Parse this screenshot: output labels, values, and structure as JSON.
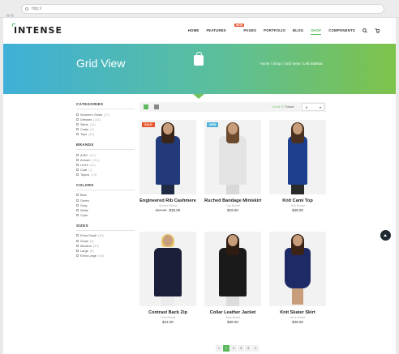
{
  "browser": {
    "url": "http://"
  },
  "site": {
    "logo": "INTENSE"
  },
  "nav": {
    "items": [
      {
        "label": "HOME"
      },
      {
        "label": "FEATURES",
        "badge": "NEW"
      },
      {
        "label": "PAGES"
      },
      {
        "label": "PORTFOLIO"
      },
      {
        "label": "BLOG"
      },
      {
        "label": "SHOP",
        "active": true
      },
      {
        "label": "COMPONENTS"
      }
    ],
    "search_icon": "search-icon",
    "cart_icon": "cart-icon"
  },
  "hero": {
    "title": "Grid View",
    "breadcrumb": "Home  /  Shop  /  Grid View  /  Left Sidebar"
  },
  "sidebar": {
    "categories": {
      "title": "CATEGORIES",
      "items": [
        {
          "label": "Women's Shirts",
          "count": "(27)"
        },
        {
          "label": "Dresses",
          "count": "(211)"
        },
        {
          "label": "Skirts",
          "count": "(12)"
        },
        {
          "label": "Coats",
          "count": "(7)"
        },
        {
          "label": "Tops",
          "count": "(19)"
        }
      ]
    },
    "brands": {
      "title": "BRANDS",
      "items": [
        {
          "label": "AJEC",
          "count": "(27)"
        },
        {
          "label": "Armani",
          "count": "(211)"
        },
        {
          "label": "Levi's",
          "count": "(12)"
        },
        {
          "label": "Coat",
          "count": "(7)"
        },
        {
          "label": "Topins",
          "count": "(19)"
        }
      ]
    },
    "colors": {
      "title": "COLORS",
      "items": [
        {
          "label": "Blue"
        },
        {
          "label": "Green"
        },
        {
          "label": "Gray"
        },
        {
          "label": "White"
        },
        {
          "label": "Cyan"
        }
      ]
    },
    "sizes": {
      "title": "SIZES",
      "items": [
        {
          "label": "Extra Small",
          "count": "(30)"
        },
        {
          "label": "Small",
          "count": "(5)"
        },
        {
          "label": "Medium",
          "count": "(90)"
        },
        {
          "label": "Large",
          "count": "(5)"
        },
        {
          "label": "Extra Large",
          "count": "(16)"
        }
      ]
    }
  },
  "toolbar": {
    "results": "1-6 of 17",
    "show_label": "Show:",
    "show_value": "6"
  },
  "products": [
    {
      "name": "Engineered Rib Cashmere",
      "brand": "Armani Brand",
      "old_price": "$57.00",
      "price": "$35.00",
      "tag": "SALE"
    },
    {
      "name": "Ruched Bandage Miniskirt",
      "brand": "Cap Brand",
      "price": "$19.00",
      "tag": "NEW"
    },
    {
      "name": "Knit Cami Top",
      "brand": "Arts Brand",
      "price": "$48.00"
    },
    {
      "name": "Contrast Back Zip",
      "brand": "Polo Brand",
      "price": "$14.00"
    },
    {
      "name": "Collar Leather Jacket",
      "brand": "Jeep Brand",
      "price": "$38.00"
    },
    {
      "name": "Knit Skater Skirt",
      "brand": "Ares Brand",
      "price": "$48.00"
    }
  ],
  "pager": {
    "prev": "«",
    "pages": [
      "1",
      "2",
      "3",
      "4"
    ],
    "next": "»"
  },
  "colors": {
    "accent": "#5cb85c",
    "sale": "#e8542e",
    "new": "#4fb3d9"
  }
}
